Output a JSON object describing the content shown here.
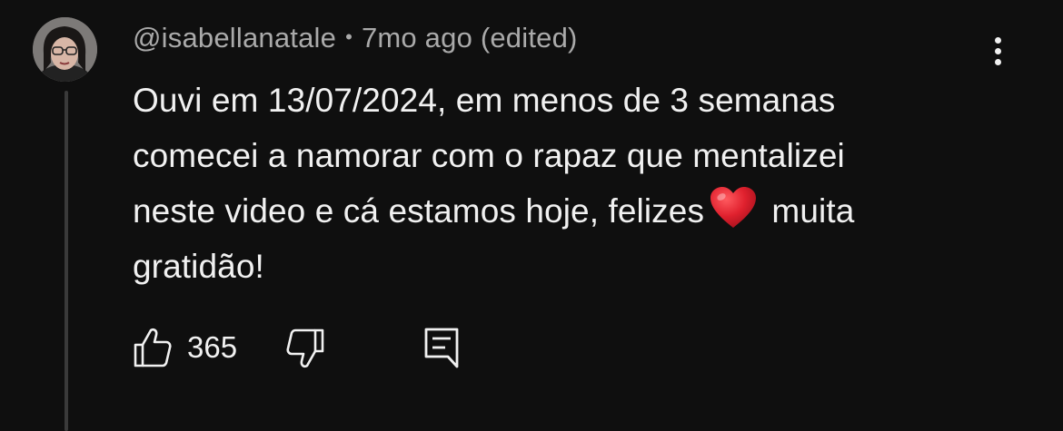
{
  "comment": {
    "author": "@isabellanatale",
    "separator": "•",
    "timestamp": "7mo ago (edited)",
    "text_before_emoji": "Ouvi em 13/07/2024, em menos de 3 semanas\ncomecei a namorar com o rapaz que mentalizei\nneste video e cá estamos hoje, felizes",
    "emoji": "red-heart",
    "text_after_emoji": " muita\ngratidão!",
    "likes": "365"
  },
  "icons": {
    "more": "vertical-ellipsis-icon",
    "like": "thumbs-up-icon",
    "dislike": "thumbs-down-icon",
    "reply": "reply-comment-icon"
  },
  "colors": {
    "background": "#0f0f0f",
    "primary_text": "#f1f1f1",
    "secondary_text": "#aaaaaa",
    "thread_line": "#3a3a3a",
    "heart": "#e0212e"
  }
}
